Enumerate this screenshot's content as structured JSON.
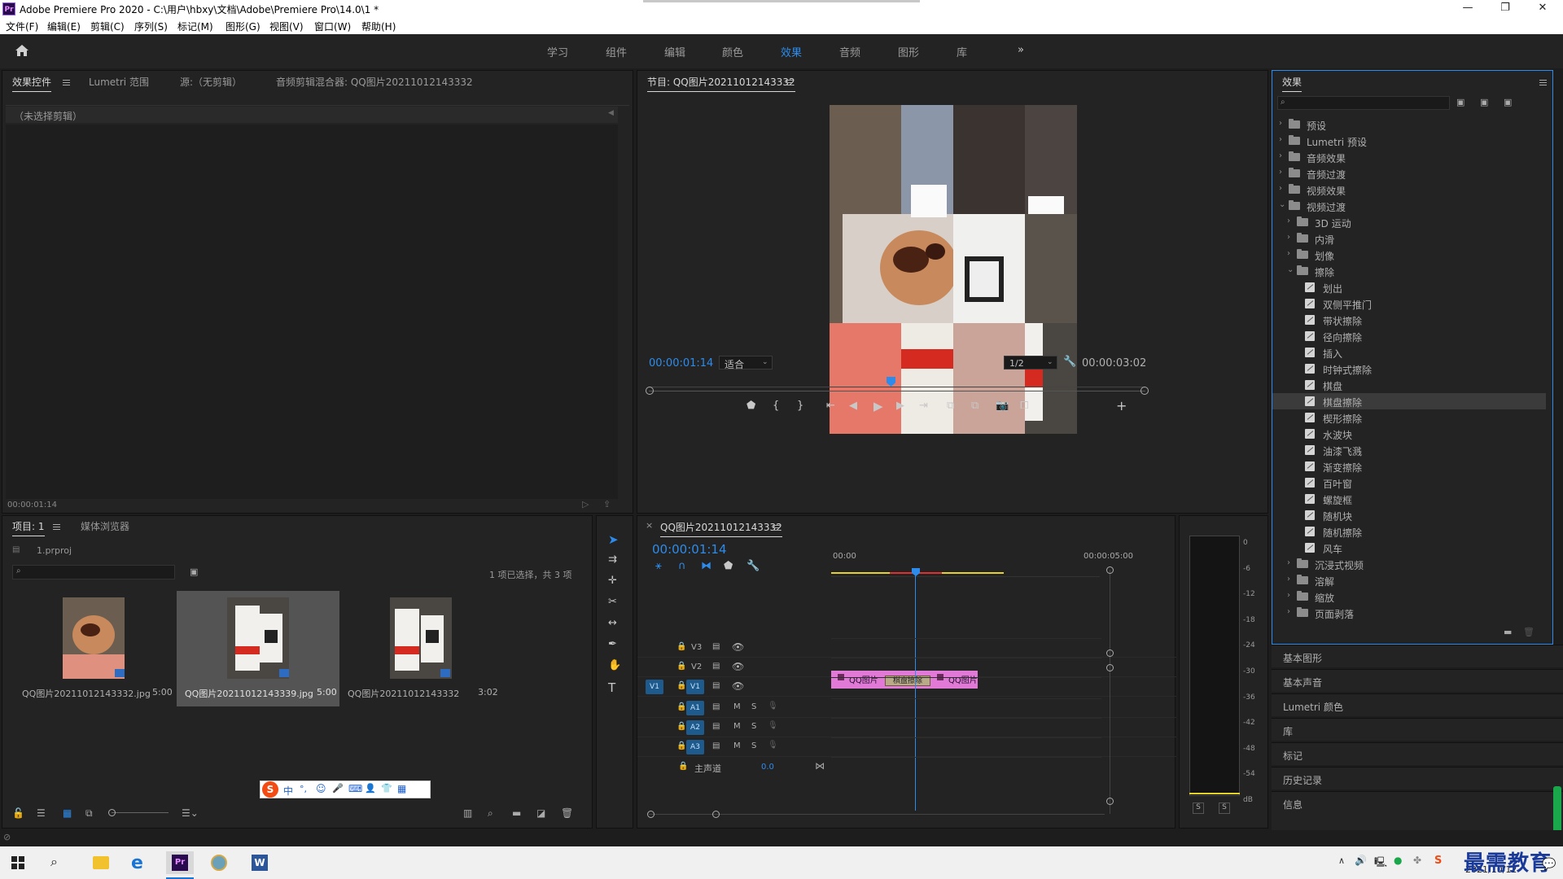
{
  "window": {
    "title": "Adobe Premiere Pro 2020 - C:\\用户\\hbxy\\文档\\Adobe\\Premiere Pro\\14.0\\1 *",
    "logo": "Pr",
    "controls": [
      "—",
      "❐",
      "✕"
    ]
  },
  "menu": [
    "文件(F)",
    "编辑(E)",
    "剪辑(C)",
    "序列(S)",
    "标记(M)",
    "图形(G)",
    "视图(V)",
    "窗口(W)",
    "帮助(H)"
  ],
  "workspaces": [
    {
      "label": "学习",
      "active": false
    },
    {
      "label": "组件",
      "active": false
    },
    {
      "label": "编辑",
      "active": false
    },
    {
      "label": "颜色",
      "active": false
    },
    {
      "label": "效果",
      "active": true
    },
    {
      "label": "音频",
      "active": false
    },
    {
      "label": "图形",
      "active": false
    },
    {
      "label": "库",
      "active": false
    }
  ],
  "workspace_more": "»",
  "effect_controls": {
    "tabs": [
      "效果控件",
      "Lumetri 范围",
      "源:（无剪辑）",
      "音频剪辑混合器: QQ图片20211012143332"
    ],
    "empty_label": "（未选择剪辑）",
    "timecode": "00:00:01:14"
  },
  "program": {
    "title": "节目: QQ图片20211012143332",
    "timecode": "00:00:01:14",
    "fit": "适合",
    "resolution": "1/2",
    "duration": "00:00:03:02",
    "playhead": 0.5
  },
  "effects_panel": {
    "title": "效果",
    "search_placeholder": "",
    "tree": [
      {
        "label": "预设",
        "level": 0,
        "kind": "preset",
        "open": false
      },
      {
        "label": "Lumetri 预设",
        "level": 0,
        "kind": "preset",
        "open": false
      },
      {
        "label": "音频效果",
        "level": 0,
        "kind": "folder",
        "open": false
      },
      {
        "label": "音频过渡",
        "level": 0,
        "kind": "folder",
        "open": false
      },
      {
        "label": "视频效果",
        "level": 0,
        "kind": "folder",
        "open": false
      },
      {
        "label": "视频过渡",
        "level": 0,
        "kind": "folder",
        "open": true
      },
      {
        "label": "3D 运动",
        "level": 1,
        "kind": "folder",
        "open": false
      },
      {
        "label": "内滑",
        "level": 1,
        "kind": "folder",
        "open": false
      },
      {
        "label": "划像",
        "level": 1,
        "kind": "folder",
        "open": false
      },
      {
        "label": "擦除",
        "level": 1,
        "kind": "folder",
        "open": true
      },
      {
        "label": "划出",
        "level": 2,
        "kind": "fx"
      },
      {
        "label": "双侧平推门",
        "level": 2,
        "kind": "fx"
      },
      {
        "label": "带状擦除",
        "level": 2,
        "kind": "fx"
      },
      {
        "label": "径向擦除",
        "level": 2,
        "kind": "fx"
      },
      {
        "label": "插入",
        "level": 2,
        "kind": "fx"
      },
      {
        "label": "时钟式擦除",
        "level": 2,
        "kind": "fx"
      },
      {
        "label": "棋盘",
        "level": 2,
        "kind": "fx"
      },
      {
        "label": "棋盘擦除",
        "level": 2,
        "kind": "fx",
        "selected": true
      },
      {
        "label": "楔形擦除",
        "level": 2,
        "kind": "fx"
      },
      {
        "label": "水波块",
        "level": 2,
        "kind": "fx"
      },
      {
        "label": "油漆飞溅",
        "level": 2,
        "kind": "fx"
      },
      {
        "label": "渐变擦除",
        "level": 2,
        "kind": "fx"
      },
      {
        "label": "百叶窗",
        "level": 2,
        "kind": "fx"
      },
      {
        "label": "螺旋框",
        "level": 2,
        "kind": "fx"
      },
      {
        "label": "随机块",
        "level": 2,
        "kind": "fx"
      },
      {
        "label": "随机擦除",
        "level": 2,
        "kind": "fx"
      },
      {
        "label": "风车",
        "level": 2,
        "kind": "fx"
      },
      {
        "label": "沉浸式视频",
        "level": 1,
        "kind": "folder",
        "open": false
      },
      {
        "label": "溶解",
        "level": 1,
        "kind": "folder",
        "open": false
      },
      {
        "label": "缩放",
        "level": 1,
        "kind": "folder",
        "open": false
      },
      {
        "label": "页面剥落",
        "level": 1,
        "kind": "folder",
        "open": false
      }
    ],
    "side_sections": [
      "基本图形",
      "基本声音",
      "Lumetri 颜色",
      "库",
      "标记",
      "历史记录",
      "信息"
    ]
  },
  "project": {
    "tabs": [
      "项目: 1",
      "媒体浏览器"
    ],
    "filename": "1.prproj",
    "selection_info": "1 项已选择，共 3 项",
    "items": [
      {
        "name": "QQ图片20211012143332.jpg",
        "duration": "5:00",
        "selected": false
      },
      {
        "name": "QQ图片20211012143339.jpg",
        "duration": "5:00",
        "selected": true
      },
      {
        "name": "QQ图片20211012143332",
        "duration": "3:02",
        "selected": false
      }
    ]
  },
  "ime_bar": [
    "S",
    "中",
    "°,",
    "☺",
    "🎤",
    "⌨",
    "👤",
    "👕",
    "▦"
  ],
  "timeline": {
    "title": "QQ图片20211012143332",
    "timecode": "00:00:01:14",
    "ruler": [
      "00:00",
      "00:00:05:00"
    ],
    "tracks_video": [
      {
        "name": "V3",
        "source": ""
      },
      {
        "name": "V2",
        "source": ""
      },
      {
        "name": "V1",
        "source": "V1"
      }
    ],
    "tracks_audio": [
      {
        "name": "A1",
        "m": "M",
        "s": "S"
      },
      {
        "name": "A2",
        "m": "M",
        "s": "S"
      },
      {
        "name": "A3",
        "m": "M",
        "s": "S"
      }
    ],
    "master": {
      "label": "主声道",
      "value": "0.0"
    },
    "clips": [
      {
        "label": "QQ图片",
        "start": 0.0,
        "end": 1.6
      },
      {
        "label": "QQ图片",
        "start": 1.6,
        "end": 3.0
      }
    ],
    "transition": "棋盘擦除",
    "playhead_s": 1.58
  },
  "meter": {
    "scale": [
      "0",
      "-6",
      "-12",
      "-18",
      "-24",
      "-30",
      "-36",
      "-42",
      "-48",
      "-54",
      "dB"
    ],
    "buttons": [
      "S",
      "S"
    ]
  },
  "taskbar": {
    "time": "",
    "date": "2021/10/12",
    "watermark": "最需教育"
  },
  "colors": {
    "accent": "#2d8ceb",
    "clip_pink": "#e07ad6",
    "track_blue": "#1e5a8c",
    "bg": "#1d1d1d",
    "panel": "#232323"
  }
}
